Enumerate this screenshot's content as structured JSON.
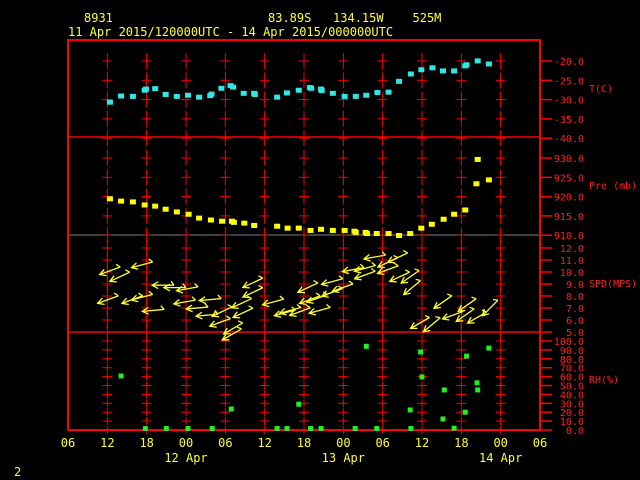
{
  "header": {
    "station": "8931",
    "location": "83.89S   134.15W    525M",
    "period": "11 Apr 2015/120000UTC - 14 Apr 2015/000000UTC"
  },
  "page_number": "2",
  "colors": {
    "frame": "#ff0000",
    "temperature": "#33e6e6",
    "pressure": "#ffff00",
    "wind": "#ffff33",
    "rh": "#22ee22",
    "text": "#ffff33"
  },
  "chart_data": {
    "type": "scatter",
    "title": "8931 83.89S 134.15W 525M",
    "x_axis": {
      "unit": "hours since 11 Apr 2015 06UTC",
      "range": [
        0,
        72
      ],
      "tick_step": 6,
      "tick_labels": [
        "06",
        "12",
        "18",
        "00",
        "06",
        "12",
        "18",
        "00",
        "06",
        "12",
        "18",
        "00",
        "06"
      ],
      "date_labels": [
        {
          "label": "12 Apr",
          "hour": 18
        },
        {
          "label": "13 Apr",
          "hour": 42
        },
        {
          "label": "14 Apr",
          "hour": 66
        }
      ]
    },
    "panels": [
      {
        "name": "temperature",
        "label": "T(C)",
        "range": [
          -40,
          -20
        ],
        "ticks": [
          "-20.0",
          "-25.0",
          "-30.0",
          "-35.0",
          "-40.0"
        ],
        "tick_values": [
          -20,
          -25,
          -30,
          -35,
          -40
        ],
        "points": [
          [
            6.4,
            -30.8
          ],
          [
            8.1,
            -29.2
          ],
          [
            9.9,
            -29.3
          ],
          [
            11.7,
            -27.7
          ],
          [
            11.9,
            -27.4
          ],
          [
            13.3,
            -27.3
          ],
          [
            14.9,
            -28.8
          ],
          [
            16.6,
            -29.3
          ],
          [
            18.3,
            -29.0
          ],
          [
            20.0,
            -29.5
          ],
          [
            21.7,
            -29.1
          ],
          [
            21.9,
            -28.7
          ],
          [
            23.4,
            -27.2
          ],
          [
            24.8,
            -26.5
          ],
          [
            25.2,
            -26.9
          ],
          [
            26.8,
            -28.5
          ],
          [
            28.4,
            -28.5
          ],
          [
            28.5,
            -28.8
          ],
          [
            31.9,
            -29.5
          ],
          [
            33.4,
            -28.4
          ],
          [
            35.2,
            -27.7
          ],
          [
            36.9,
            -27.0
          ],
          [
            37.1,
            -27.2
          ],
          [
            38.6,
            -27.4
          ],
          [
            38.7,
            -27.8
          ],
          [
            40.4,
            -28.5
          ],
          [
            42.2,
            -29.3
          ],
          [
            43.9,
            -29.3
          ],
          [
            45.5,
            -29.0
          ],
          [
            47.2,
            -28.3
          ],
          [
            48.9,
            -28.2
          ],
          [
            50.5,
            -25.4
          ],
          [
            52.3,
            -23.5
          ],
          [
            53.9,
            -22.4
          ],
          [
            55.6,
            -21.9
          ],
          [
            57.2,
            -22.7
          ],
          [
            58.9,
            -22.7
          ],
          [
            60.6,
            -21.4
          ],
          [
            60.8,
            -21.1
          ],
          [
            62.5,
            -20.1
          ],
          [
            64.2,
            -20.9
          ]
        ]
      },
      {
        "name": "pressure",
        "label": "Pre (mb)",
        "range": [
          910,
          930
        ],
        "ticks": [
          "930.0",
          "925.0",
          "920.0",
          "915.0",
          "910.0"
        ],
        "tick_values": [
          930,
          925,
          920,
          915,
          910
        ],
        "points": [
          [
            6.4,
            919.3
          ],
          [
            8.1,
            918.7
          ],
          [
            9.9,
            918.5
          ],
          [
            11.7,
            917.7
          ],
          [
            13.3,
            917.4
          ],
          [
            14.9,
            916.6
          ],
          [
            16.6,
            915.9
          ],
          [
            18.4,
            915.3
          ],
          [
            20.0,
            914.3
          ],
          [
            21.8,
            913.8
          ],
          [
            23.5,
            913.5
          ],
          [
            25.0,
            913.5
          ],
          [
            25.3,
            913.2
          ],
          [
            26.9,
            913.0
          ],
          [
            28.4,
            912.4
          ],
          [
            31.9,
            912.2
          ],
          [
            33.5,
            911.7
          ],
          [
            35.2,
            911.7
          ],
          [
            37.0,
            911.1
          ],
          [
            38.6,
            911.4
          ],
          [
            40.4,
            911.1
          ],
          [
            42.2,
            911.1
          ],
          [
            43.7,
            910.9
          ],
          [
            43.9,
            910.6
          ],
          [
            45.4,
            910.6
          ],
          [
            45.6,
            910.3
          ],
          [
            47.1,
            910.3
          ],
          [
            48.9,
            910.3
          ],
          [
            50.5,
            909.8
          ],
          [
            52.2,
            910.3
          ],
          [
            53.9,
            911.7
          ],
          [
            55.5,
            912.7
          ],
          [
            57.3,
            914.0
          ],
          [
            58.9,
            915.3
          ],
          [
            60.6,
            916.4
          ],
          [
            62.3,
            923.2
          ],
          [
            62.5,
            929.5
          ],
          [
            64.2,
            924.2
          ]
        ]
      },
      {
        "name": "wind",
        "label": "SPD(MPS)",
        "range": [
          5,
          12
        ],
        "ticks": [
          "12.0",
          "11.0",
          "10.0",
          "9.0",
          "8.0",
          "7.0",
          "6.0",
          "5.0"
        ],
        "tick_values": [
          12,
          11,
          10,
          9,
          8,
          7,
          6,
          5
        ],
        "points_hour_speed_dirfrom": [
          [
            6.4,
            10.1,
            70
          ],
          [
            7.9,
            9.6,
            65
          ],
          [
            11.3,
            10.6,
            75
          ],
          [
            6.1,
            7.7,
            70
          ],
          [
            9.8,
            7.7,
            70
          ],
          [
            11.3,
            7.9,
            75
          ],
          [
            14.5,
            8.9,
            90
          ],
          [
            16.3,
            8.7,
            90
          ],
          [
            18.2,
            8.6,
            80
          ],
          [
            13.0,
            6.8,
            85
          ],
          [
            17.8,
            7.5,
            80
          ],
          [
            19.7,
            7.0,
            85
          ],
          [
            21.7,
            7.7,
            85
          ],
          [
            21.2,
            6.4,
            85
          ],
          [
            23.2,
            5.8,
            70
          ],
          [
            25.0,
            4.8,
            60
          ],
          [
            25.2,
            5.3,
            60
          ],
          [
            26.7,
            6.6,
            65
          ],
          [
            26.5,
            7.4,
            65
          ],
          [
            23.5,
            6.7,
            65
          ],
          [
            28.2,
            8.3,
            65
          ],
          [
            28.2,
            9.1,
            65
          ],
          [
            31.3,
            7.5,
            75
          ],
          [
            33.1,
            6.6,
            75
          ],
          [
            33.9,
            6.8,
            75
          ],
          [
            35.4,
            6.7,
            70
          ],
          [
            36.9,
            7.7,
            70
          ],
          [
            38.4,
            6.8,
            75
          ],
          [
            36.6,
            8.7,
            65
          ],
          [
            38.0,
            7.8,
            70
          ],
          [
            40.3,
            9.2,
            75
          ],
          [
            40.3,
            8.3,
            70
          ],
          [
            41.9,
            8.7,
            70
          ],
          [
            43.5,
            10.2,
            80
          ],
          [
            45.3,
            10.3,
            75
          ],
          [
            45.3,
            9.75,
            70
          ],
          [
            46.8,
            11.25,
            80
          ],
          [
            48.8,
            10.8,
            65
          ],
          [
            50.3,
            11.2,
            65
          ],
          [
            48.8,
            10.2,
            70
          ],
          [
            50.6,
            9.6,
            65
          ],
          [
            52.2,
            9.6,
            55
          ],
          [
            52.5,
            8.7,
            50
          ],
          [
            57.2,
            7.5,
            55
          ],
          [
            53.7,
            5.75,
            60
          ],
          [
            55.5,
            5.6,
            50
          ],
          [
            58.7,
            6.4,
            70
          ],
          [
            60.9,
            7.25,
            55
          ],
          [
            60.6,
            6.4,
            55
          ],
          [
            62.4,
            6.2,
            60
          ],
          [
            64.4,
            7.0,
            45
          ]
        ]
      },
      {
        "name": "rh",
        "label": "RH(%)",
        "range": [
          0,
          100
        ],
        "ticks": [
          "100.0",
          "90.0",
          "80.0",
          "70.0",
          "60.0",
          "50.0",
          "40.0",
          "30.0",
          "20.0",
          "10.0",
          "0.0"
        ],
        "tick_values": [
          100,
          90,
          80,
          70,
          60,
          50,
          40,
          30,
          20,
          10,
          0
        ],
        "points": [
          [
            8.1,
            60.7
          ],
          [
            11.8,
            1
          ],
          [
            15.0,
            1
          ],
          [
            18.3,
            1
          ],
          [
            22.0,
            1
          ],
          [
            24.9,
            23.6
          ],
          [
            31.9,
            1
          ],
          [
            33.4,
            1
          ],
          [
            35.2,
            29
          ],
          [
            37.0,
            1
          ],
          [
            38.6,
            1
          ],
          [
            43.8,
            1
          ],
          [
            45.5,
            94
          ],
          [
            47.1,
            1
          ],
          [
            52.2,
            22.5
          ],
          [
            52.3,
            1
          ],
          [
            53.8,
            87.6
          ],
          [
            54.0,
            59.6
          ],
          [
            57.2,
            12.4
          ],
          [
            57.4,
            45
          ],
          [
            58.9,
            2
          ],
          [
            60.6,
            20
          ],
          [
            60.8,
            83
          ],
          [
            62.4,
            53
          ],
          [
            62.5,
            45
          ],
          [
            64.2,
            92
          ]
        ]
      }
    ]
  }
}
